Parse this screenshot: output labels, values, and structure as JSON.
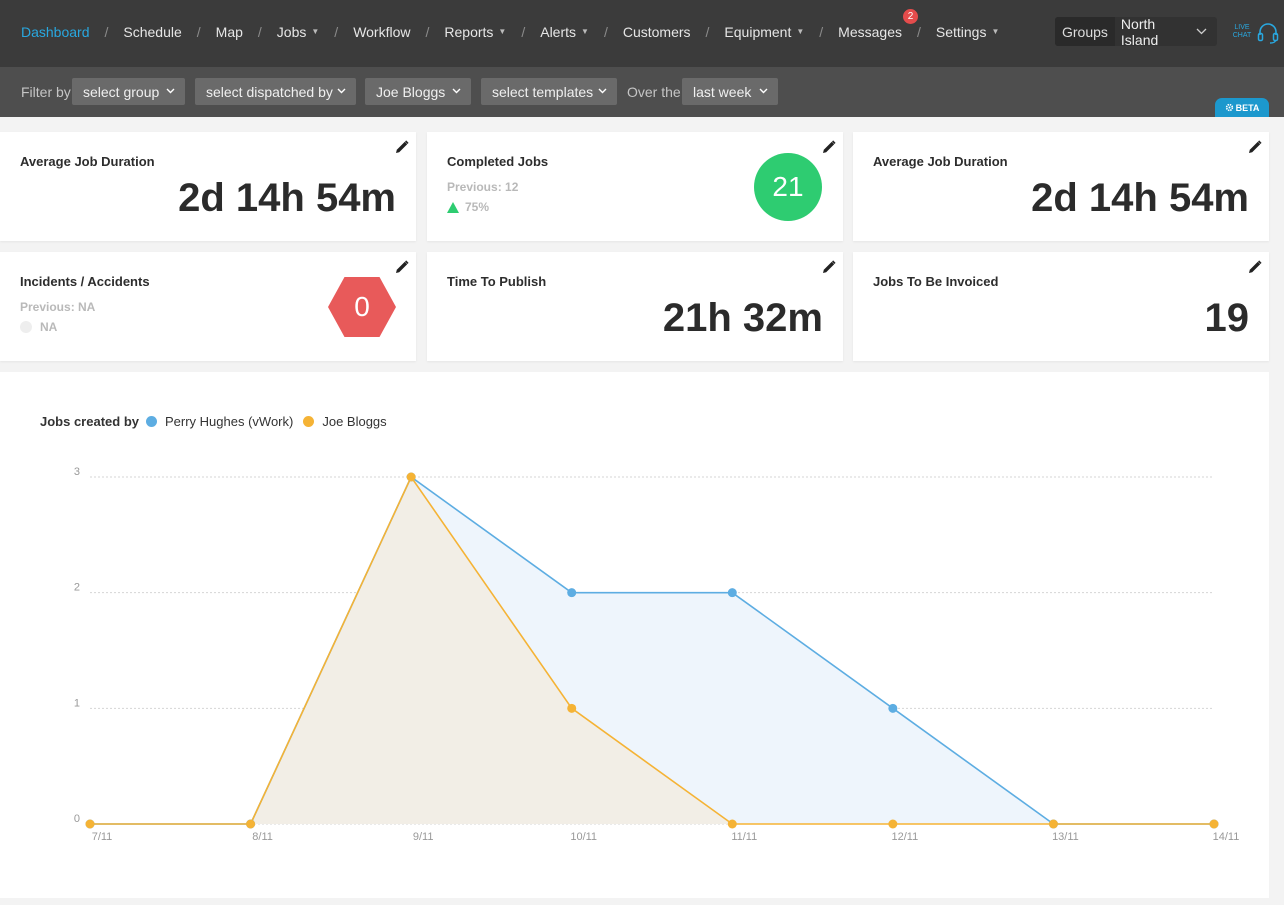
{
  "nav": {
    "items": [
      {
        "label": "Dashboard",
        "active": true,
        "dropdown": false
      },
      {
        "label": "Schedule",
        "dropdown": false
      },
      {
        "label": "Map",
        "dropdown": false
      },
      {
        "label": "Jobs",
        "dropdown": true
      },
      {
        "label": "Workflow",
        "dropdown": false
      },
      {
        "label": "Reports",
        "dropdown": true
      },
      {
        "label": "Alerts",
        "dropdown": true
      },
      {
        "label": "Customers",
        "dropdown": false
      },
      {
        "label": "Equipment",
        "dropdown": true
      },
      {
        "label": "Messages",
        "dropdown": false,
        "badge": "2"
      },
      {
        "label": "Settings",
        "dropdown": true
      }
    ],
    "separator": "/",
    "groups_label": "Groups",
    "groups_value": "North Island",
    "live_chat": "LIVE CHAT",
    "icons": {
      "dropdown": "caret-down-icon",
      "groups": "chevron-down-icon",
      "live_chat": "headset-icon"
    },
    "accent_color": "#29a8e0"
  },
  "filters": {
    "filter_by_label": "Filter by",
    "group": "select group",
    "dispatched_by": "select dispatched by",
    "user": "Joe Bloggs",
    "templates": "select templates",
    "over_the_label": "Over the",
    "period": "last week",
    "beta": "BETA"
  },
  "cards": {
    "avg_duration_1": {
      "title": "Average Job Duration",
      "value": "2d 14h 54m"
    },
    "completed_jobs": {
      "title": "Completed Jobs",
      "previous": "Previous: 12",
      "trend": "75%",
      "value": "21",
      "color": "#2ecc71"
    },
    "avg_duration_2": {
      "title": "Average Job Duration",
      "value": "2d 14h 54m"
    },
    "incidents": {
      "title": "Incidents / Accidents",
      "previous": "Previous: NA",
      "trend": "NA",
      "value": "0",
      "color": "#e85a5a"
    },
    "time_to_publish": {
      "title": "Time To Publish",
      "value": "21h 32m"
    },
    "to_be_invoiced": {
      "title": "Jobs To Be Invoiced",
      "value": "19"
    }
  },
  "chart_data": {
    "type": "area",
    "legend_title": "Jobs created by",
    "categories": [
      "7/11",
      "8/11",
      "9/11",
      "10/11",
      "11/11",
      "12/11",
      "13/11",
      "14/11"
    ],
    "yticks": [
      0,
      1,
      2,
      3
    ],
    "ylim": [
      0,
      3
    ],
    "grid": true,
    "legend_position": "top-left",
    "series": [
      {
        "name": "Perry Hughes (vWork)",
        "color": "#5dade2",
        "fill": "#eef5fc",
        "values": [
          0,
          0,
          3,
          2,
          2,
          1,
          0,
          0
        ]
      },
      {
        "name": "Joe Bloggs",
        "color": "#f5b335",
        "fill": "#f2eee6",
        "values": [
          0,
          0,
          3,
          1,
          0,
          0,
          0,
          0
        ]
      }
    ]
  }
}
